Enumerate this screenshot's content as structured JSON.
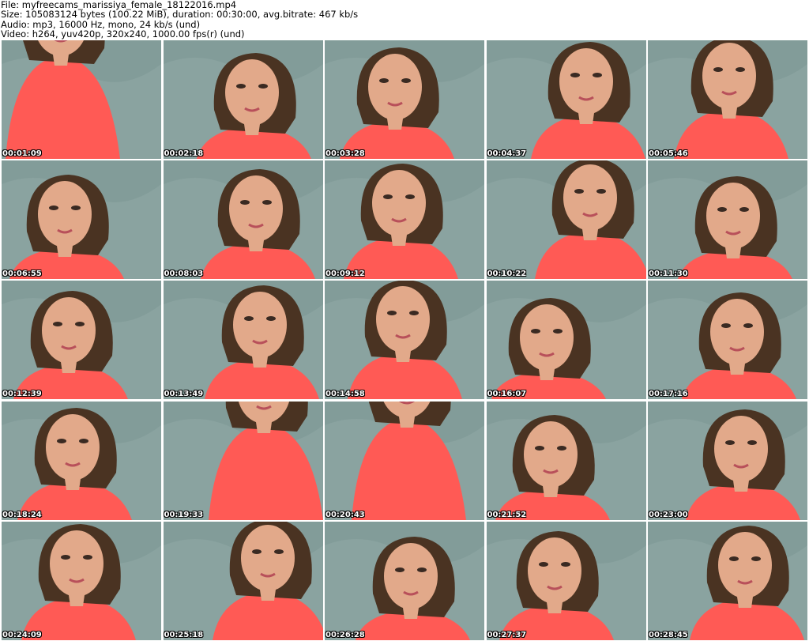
{
  "header": {
    "file_line": "File: myfreecams_marissiya_female_18122016.mp4",
    "size_line": "Size: 105083124 bytes (100.22 MiB), duration: 00:30:00, avg.bitrate: 467 kb/s",
    "audio_line": "Audio: mp3, 16000 Hz, mono, 24 kb/s (und)",
    "video_line": "Video: h264, yuv420p, 320x240, 1000.00 fps(r) (und)"
  },
  "thumbnails": [
    {
      "timestamp": "00:01:09"
    },
    {
      "timestamp": "00:02:18"
    },
    {
      "timestamp": "00:03:28"
    },
    {
      "timestamp": "00:04:37"
    },
    {
      "timestamp": "00:05:46"
    },
    {
      "timestamp": "00:06:55"
    },
    {
      "timestamp": "00:08:03"
    },
    {
      "timestamp": "00:09:12"
    },
    {
      "timestamp": "00:10:22"
    },
    {
      "timestamp": "00:11:30"
    },
    {
      "timestamp": "00:12:39"
    },
    {
      "timestamp": "00:13:49"
    },
    {
      "timestamp": "00:14:58"
    },
    {
      "timestamp": "00:16:07"
    },
    {
      "timestamp": "00:17:16"
    },
    {
      "timestamp": "00:18:24"
    },
    {
      "timestamp": "00:19:33"
    },
    {
      "timestamp": "00:20:43"
    },
    {
      "timestamp": "00:21:52"
    },
    {
      "timestamp": "00:23:00"
    },
    {
      "timestamp": "00:24:09"
    },
    {
      "timestamp": "00:25:18"
    },
    {
      "timestamp": "00:26:28"
    },
    {
      "timestamp": "00:27:37"
    },
    {
      "timestamp": "00:28:45"
    }
  ],
  "colors": {
    "wall": "#8aa3a0",
    "shirt": "#ff5a55",
    "skin": "#e2a98a",
    "hair": "#4a3322",
    "timestamp_text": "#ffffff"
  }
}
